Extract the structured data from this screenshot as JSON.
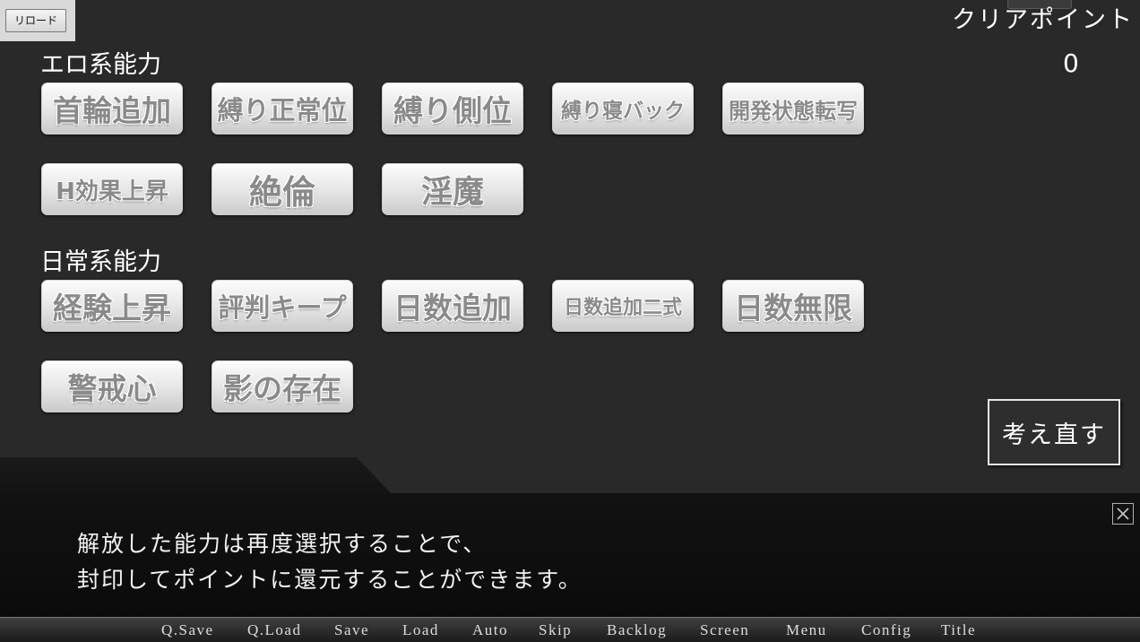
{
  "reload_button": {
    "label": "リロード"
  },
  "clear_points": {
    "label": "クリアポイント",
    "value": 0
  },
  "sections": [
    {
      "title": "エロ系能力",
      "abilities": [
        "首輪追加",
        "縛り正常位",
        "縛り側位",
        "縛り寝バック",
        "開発状態転写",
        "H効果上昇",
        "絶倫",
        "淫魔"
      ]
    },
    {
      "title": "日常系能力",
      "abilities": [
        "経験上昇",
        "評判キープ",
        "日数追加",
        "日数追加二式",
        "日数無限",
        "警戒心",
        "影の存在"
      ]
    }
  ],
  "reconsider_button": {
    "label": "考え直す"
  },
  "message": {
    "lines": [
      "解放した能力は再度選択することで、",
      "封印してポイントに還元することができます。"
    ]
  },
  "icons": {
    "close": "close-icon"
  },
  "menu_bar": {
    "items": [
      "Q.Save",
      "Q.Load",
      "Save",
      "Load",
      "Auto",
      "Skip",
      "Backlog",
      "Screen",
      "Menu",
      "Config",
      "Title"
    ]
  },
  "colors": {
    "background": "#292929",
    "message_box": "#111111",
    "button_text": "#8a8a8a",
    "text": "#ffffff",
    "menu_text": "#dddddd"
  }
}
